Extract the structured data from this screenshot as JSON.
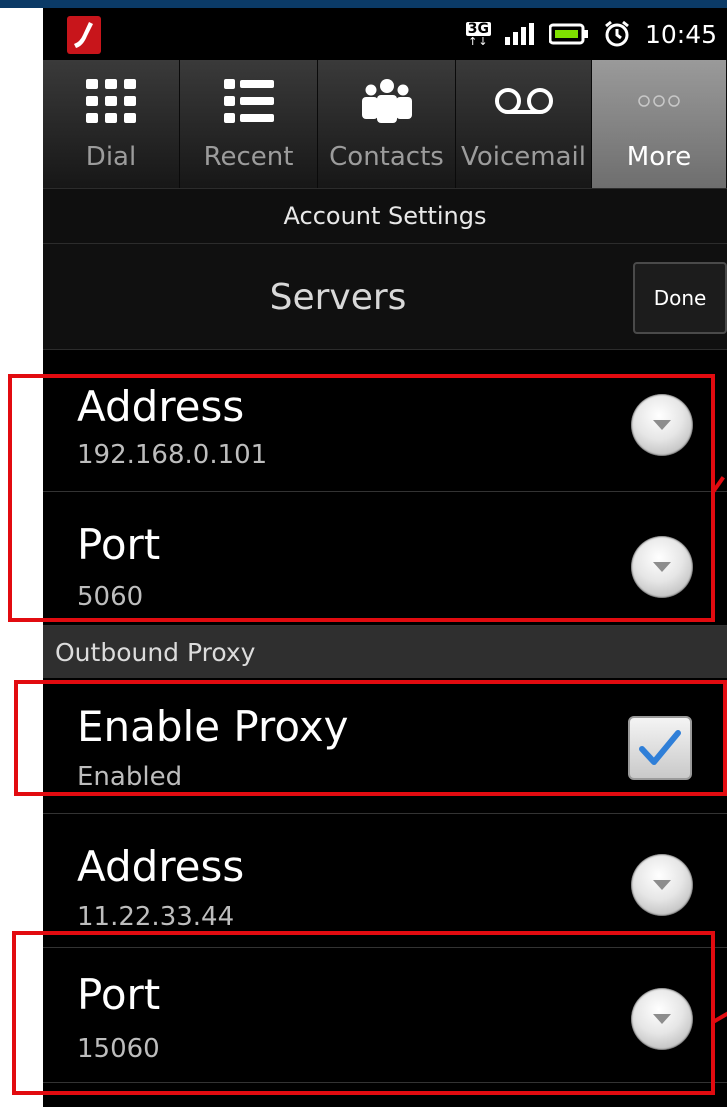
{
  "status_bar": {
    "network": "3G",
    "network_arrows": "↑↓",
    "time": "10:45"
  },
  "tabs": [
    {
      "label": "Dial",
      "icon": "dialpad-icon",
      "active": false
    },
    {
      "label": "Recent",
      "icon": "list-icon",
      "active": false
    },
    {
      "label": "Contacts",
      "icon": "contacts-icon",
      "active": false
    },
    {
      "label": "Voicemail",
      "icon": "voicemail-icon",
      "active": false
    },
    {
      "label": "More",
      "icon": "more-icon",
      "active": true
    }
  ],
  "subtitle": "Account Settings",
  "header": {
    "title": "Servers",
    "done_label": "Done"
  },
  "server": {
    "address": {
      "title": "Address",
      "value": "192.168.0.101"
    },
    "port": {
      "title": "Port",
      "value": "5060"
    }
  },
  "outbound_proxy": {
    "section_label": "Outbound Proxy",
    "enable": {
      "title": "Enable Proxy",
      "value": "Enabled",
      "checked": true
    },
    "address": {
      "title": "Address",
      "value": "11.22.33.44"
    },
    "port": {
      "title": "Port",
      "value": "15060"
    }
  },
  "colors": {
    "highlight": "#e20b10",
    "check": "#2f7fd8",
    "active_tab": "#8a8a8a"
  }
}
